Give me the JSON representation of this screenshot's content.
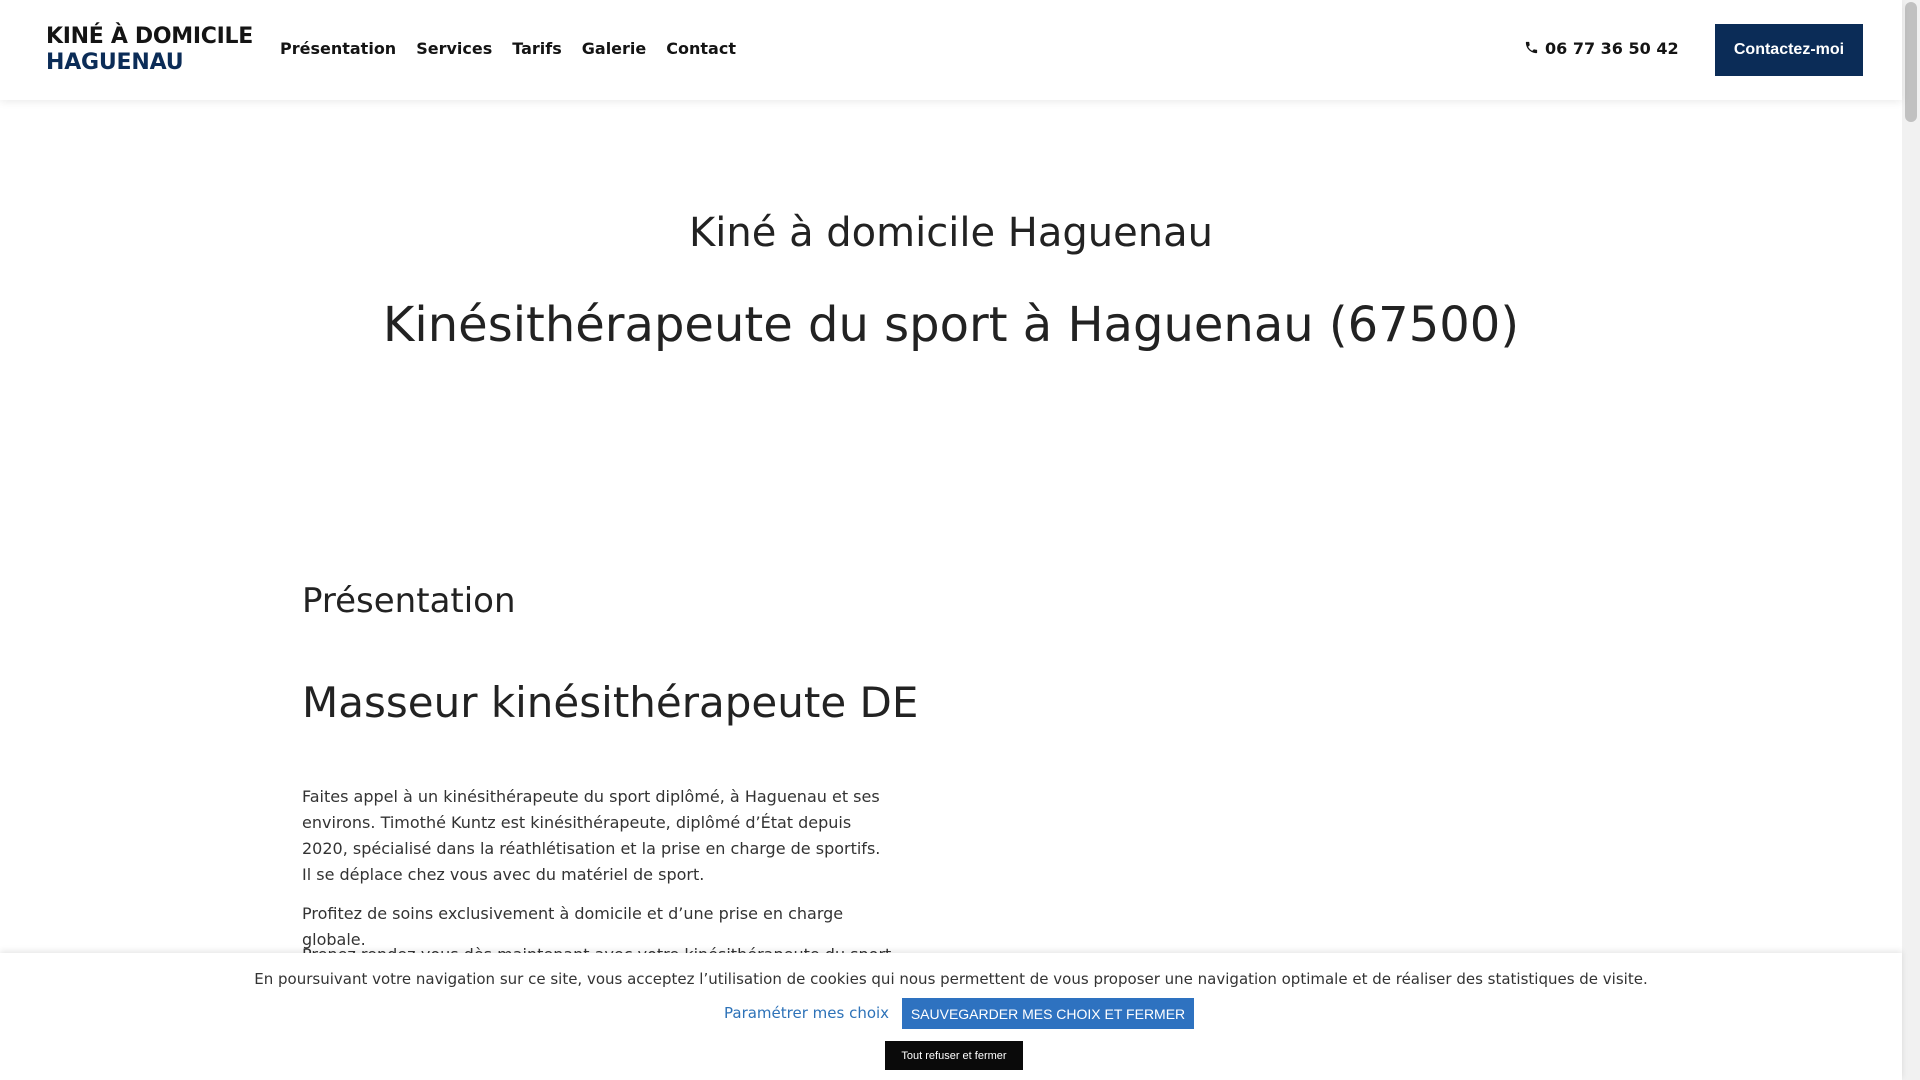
{
  "header": {
    "logo_line1": "KINÉ À DOMICILE",
    "logo_line2": "HAGUENAU",
    "nav": [
      "Présentation",
      "Services",
      "Tarifs",
      "Galerie",
      "Contact"
    ],
    "phone": "06 77 36 50 42",
    "cta_label": "Contactez-moi",
    "brand_color": "#0b2c57"
  },
  "hero": {
    "title": "Kiné à domicile Haguenau",
    "subtitle": "Kinésithérapeute du sport à Haguenau (67500)"
  },
  "presentation": {
    "title": "Présentation",
    "heading": "Masseur kinésithérapeute DE",
    "paragraphs": [
      "Faites appel à un kinésithérapeute du sport diplômé, à Haguenau et ses environs. Timothé Kuntz est kinésithérapeute, diplômé d’État depuis 2020, spécialisé dans la réathlétisation et la prise en charge de sportifs. Il se déplace chez vous avec du matériel de sport.",
      "Profitez de soins exclusivement à domicile et d’une prise en charge globale.",
      "Prenez rendez-vous dès maintenant avec votre kinésithérapeute du sport"
    ]
  },
  "cookie": {
    "message": "En poursuivant votre navigation sur ce site, vous acceptez l’utilisation de cookies qui nous permettent de vous proposer une navigation optimale et de réaliser des statistiques de visite.",
    "settings_label": "Paramétrer mes choix",
    "save_label": "SAUVEGARDER MES CHOIX ET FERMER",
    "refuse_label": "Tout refuser et fermer",
    "accent_color": "#2e72c0"
  }
}
